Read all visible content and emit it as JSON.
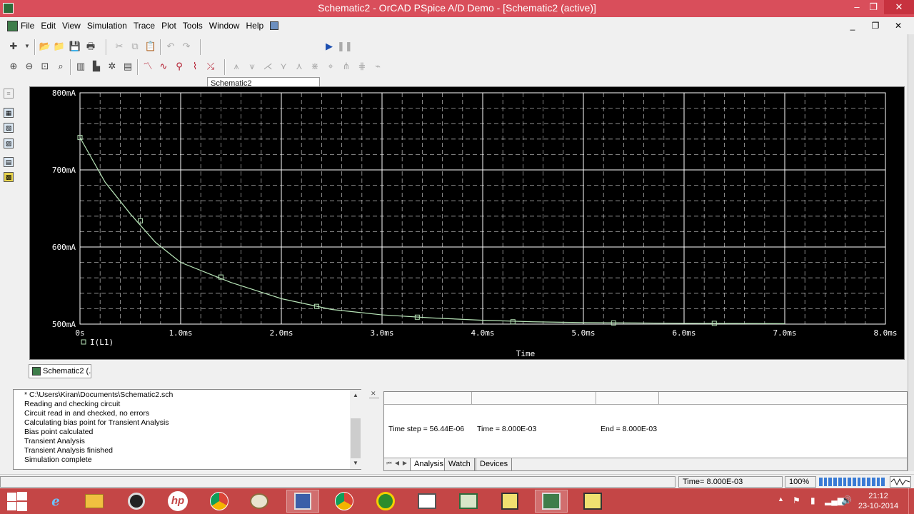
{
  "window": {
    "title": "Schematic2 - OrCAD PSpice A/D Demo  - [Schematic2 (active)]",
    "minimize_glyph": "–",
    "restore_glyph": "❐",
    "close_glyph": "✕"
  },
  "menu": {
    "items": [
      "File",
      "Edit",
      "View",
      "Simulation",
      "Trace",
      "Plot",
      "Tools",
      "Window",
      "Help"
    ],
    "mdi_minimize": "_",
    "mdi_restore": "❐",
    "mdi_close": "✕"
  },
  "toolbar": {
    "profile_value": "Schematic2",
    "run_icon": "play-icon",
    "pause_icon": "pause-icon"
  },
  "chart_data": {
    "type": "line",
    "xlabel": "Time",
    "x_unit": "ms",
    "xlim": [
      0,
      8
    ],
    "ylim": [
      500,
      800
    ],
    "y_unit": "mA",
    "x_ticks": [
      0,
      1,
      2,
      3,
      4,
      5,
      6,
      7,
      8
    ],
    "x_tick_labels": [
      "0s",
      "1.0ms",
      "2.0ms",
      "3.0ms",
      "4.0ms",
      "5.0ms",
      "6.0ms",
      "7.0ms",
      "8.0ms"
    ],
    "y_ticks": [
      800,
      700,
      600,
      500
    ],
    "y_tick_labels": [
      "800mA",
      "700mA",
      "600mA",
      "500mA"
    ],
    "grid": true,
    "legend_position": "bottom-left",
    "background": "#000000",
    "grid_color": "#ffffff",
    "trace_color": "#b7e4b7",
    "series": [
      {
        "name": "I(L1)",
        "x": [
          0,
          0.25,
          0.5,
          0.75,
          1.0,
          1.25,
          1.5,
          2.0,
          2.5,
          3.0,
          3.5,
          4.0,
          4.5,
          5.0,
          5.5,
          6.0,
          6.5,
          7.0
        ],
        "y": [
          742,
          684,
          643,
          606,
          580,
          567,
          554,
          533,
          519,
          512,
          508,
          505,
          503,
          502,
          501.5,
          501,
          500.8,
          500.6
        ],
        "markers_x": [
          0,
          0.6,
          1.4,
          2.35,
          3.35,
          4.3,
          5.3,
          6.3
        ],
        "markers_y": [
          742,
          634,
          561,
          523,
          509,
          503,
          501.5,
          501
        ]
      }
    ]
  },
  "document_tab": {
    "label": "Schematic2 (..."
  },
  "output_log": {
    "lines": [
      "* C:\\Users\\Kiran\\Documents\\Schematic2.sch",
      "Reading and checking circuit",
      "Circuit read in and checked, no errors",
      "Calculating bias point for Transient Analysis",
      "Bias point calculated",
      "Transient Analysis",
      "Transient Analysis finished",
      "Simulation complete"
    ]
  },
  "sim_status": {
    "time_step": "Time step =  56.44E-06",
    "time": "Time =  8.000E-03",
    "end": "End =  8.000E-03",
    "tabs": [
      "Analysis",
      "Watch",
      "Devices"
    ],
    "active_tab": "Analysis"
  },
  "statusbar": {
    "time": "Time= 8.000E-03",
    "zoom": "100%"
  },
  "taskbar": {
    "clock_time": "21:12",
    "clock_date": "23-10-2014"
  }
}
